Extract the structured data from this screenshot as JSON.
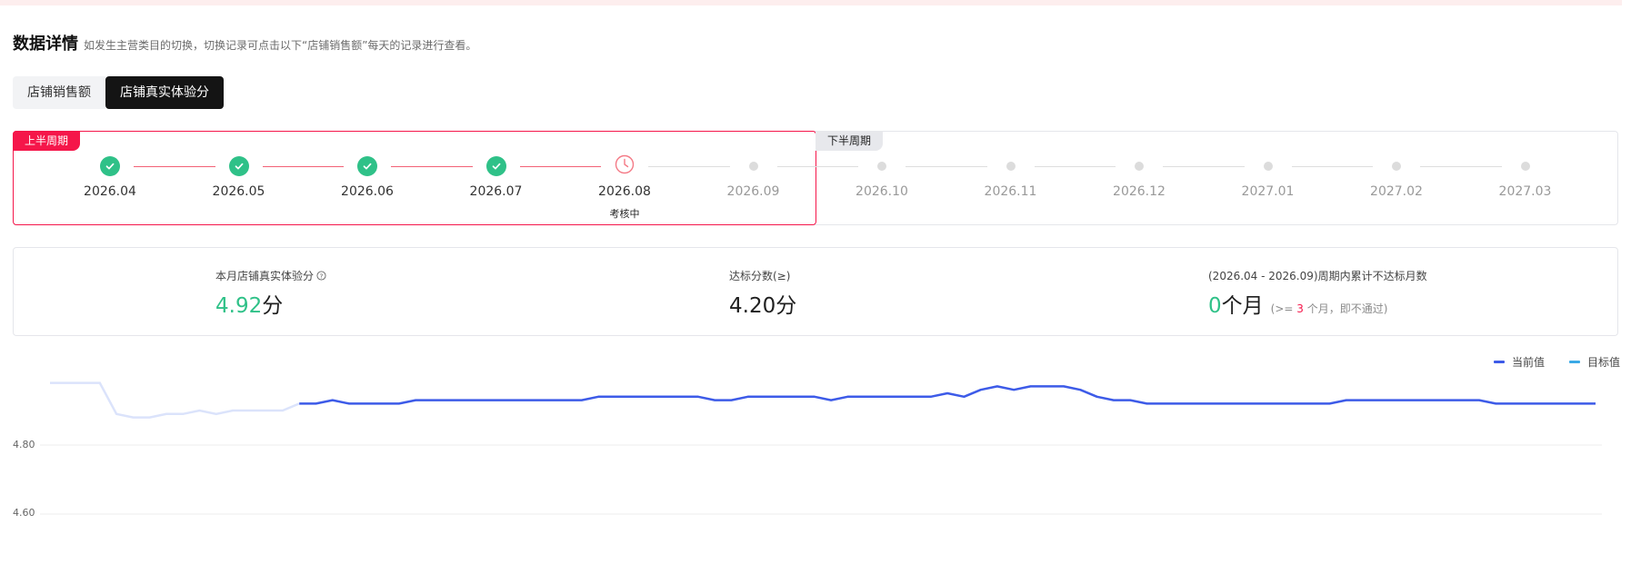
{
  "header": {
    "title": "数据详情",
    "description": "如发生主营类目的切换，切换记录可点击以下“店铺销售额”每天的记录进行查看。"
  },
  "tabs": [
    {
      "label": "店铺销售额",
      "active": false
    },
    {
      "label": "店铺真实体验分",
      "active": true
    }
  ],
  "timeline": {
    "first_half_label": "上半周期",
    "second_half_label": "下半周期",
    "months": [
      {
        "label": "2026.04",
        "state": "done"
      },
      {
        "label": "2026.05",
        "state": "done"
      },
      {
        "label": "2026.06",
        "state": "done"
      },
      {
        "label": "2026.07",
        "state": "done"
      },
      {
        "label": "2026.08",
        "state": "in-progress",
        "status": "考核中"
      },
      {
        "label": "2026.09",
        "state": "future"
      },
      {
        "label": "2026.10",
        "state": "future"
      },
      {
        "label": "2026.11",
        "state": "future"
      },
      {
        "label": "2026.12",
        "state": "future"
      },
      {
        "label": "2027.01",
        "state": "future"
      },
      {
        "label": "2027.02",
        "state": "future"
      },
      {
        "label": "2027.03",
        "state": "future"
      }
    ]
  },
  "stats": {
    "score": {
      "label": "本月店铺真实体验分",
      "value": "4.92",
      "unit": "分"
    },
    "target": {
      "label": "达标分数(≥)",
      "value": "4.20",
      "unit": "分"
    },
    "fail_count": {
      "label": "(2026.04 - 2026.09)周期内累计不达标月数",
      "value": "0",
      "unit": "个月",
      "note_prefix": "(>= ",
      "note_num": "3",
      "note_suffix": " 个月，即不通过)"
    }
  },
  "colors": {
    "accent_red": "#f5164a",
    "success_green": "#2fc188",
    "current_series": "#3d5be8",
    "target_series": "#3aa9e6"
  },
  "chart_data": {
    "type": "line",
    "legend": [
      {
        "name": "当前值",
        "color": "#3d5be8"
      },
      {
        "name": "目标值",
        "color": "#3aa9e6"
      }
    ],
    "legend_position": "top-right",
    "y_ticks": [
      "4.80",
      "4.60"
    ],
    "ylim": [
      4.55,
      5.0
    ],
    "grid": true,
    "series": [
      {
        "name": "当前值",
        "faded_leading_points": 15,
        "values": [
          4.98,
          4.98,
          4.98,
          4.98,
          4.89,
          4.88,
          4.88,
          4.89,
          4.89,
          4.9,
          4.89,
          4.9,
          4.9,
          4.9,
          4.9,
          4.92,
          4.92,
          4.93,
          4.92,
          4.92,
          4.92,
          4.92,
          4.93,
          4.93,
          4.93,
          4.93,
          4.93,
          4.93,
          4.93,
          4.93,
          4.93,
          4.93,
          4.93,
          4.94,
          4.94,
          4.94,
          4.94,
          4.94,
          4.94,
          4.94,
          4.93,
          4.93,
          4.94,
          4.94,
          4.94,
          4.94,
          4.94,
          4.93,
          4.94,
          4.94,
          4.94,
          4.94,
          4.94,
          4.94,
          4.95,
          4.94,
          4.96,
          4.97,
          4.96,
          4.97,
          4.97,
          4.97,
          4.96,
          4.94,
          4.93,
          4.93,
          4.92,
          4.92,
          4.92,
          4.92,
          4.92,
          4.92,
          4.92,
          4.92,
          4.92,
          4.92,
          4.92,
          4.92,
          4.93,
          4.93,
          4.93,
          4.93,
          4.93,
          4.93,
          4.93,
          4.93,
          4.93,
          4.92,
          4.92,
          4.92,
          4.92,
          4.92,
          4.92,
          4.92
        ]
      }
    ]
  }
}
